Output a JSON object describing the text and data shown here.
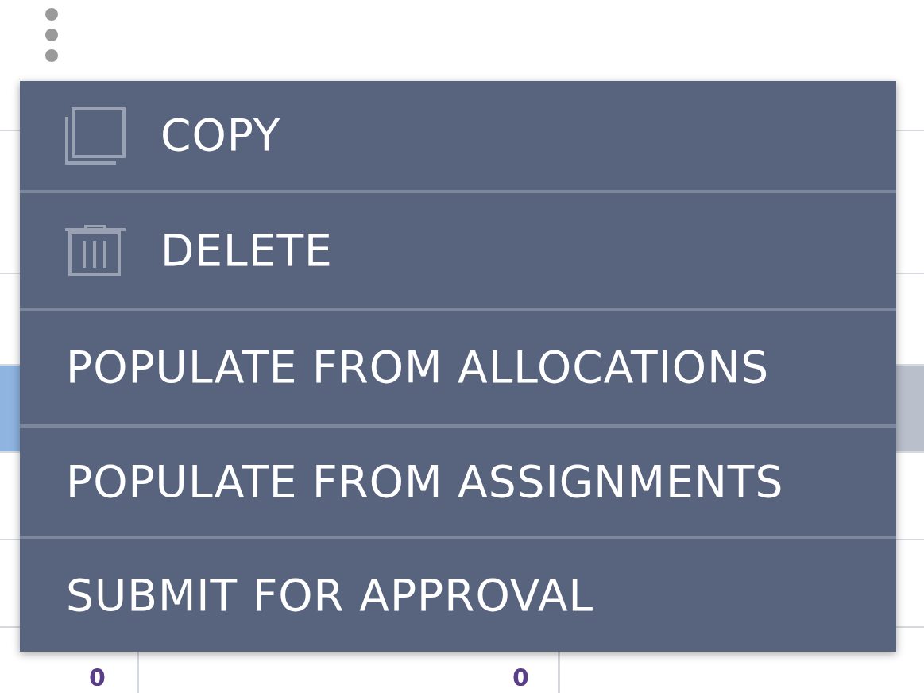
{
  "table": {
    "rows": [
      {
        "selected": false,
        "cells": []
      },
      {
        "selected": false,
        "cells": []
      },
      {
        "selected": false,
        "cells": []
      },
      {
        "selected": true,
        "cells": []
      },
      {
        "selected": false,
        "cells": []
      },
      {
        "selected": false,
        "cells": []
      },
      {
        "selected": false,
        "cells": [
          "0",
          "0"
        ]
      }
    ]
  },
  "menu": {
    "items": [
      {
        "label": "COPY",
        "kind": "copy"
      },
      {
        "label": "DELETE",
        "kind": "trash"
      },
      {
        "label": "POPULATE FROM ALLOCATIONS"
      },
      {
        "label": "POPULATE FROM ASSIGNMENTS"
      },
      {
        "label": "SUBMIT FOR APPROVAL"
      }
    ]
  }
}
